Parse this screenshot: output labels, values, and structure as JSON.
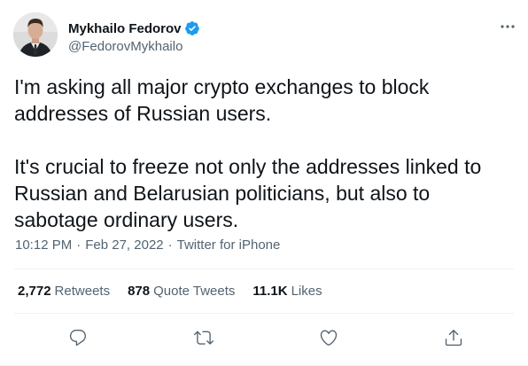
{
  "author": {
    "display_name": "Mykhailo Fedorov",
    "handle": "@FedorovMykhailo",
    "verified": true
  },
  "tweet": {
    "paragraphs": [
      "I'm asking all major crypto exchanges to block addresses of Russian users.",
      "It's crucial to freeze not only the addresses linked to Russian and Belarusian politicians, but also to sabotage ordinary users."
    ],
    "time": "10:12 PM",
    "separator": "·",
    "date": "Feb 27, 2022",
    "source": "Twitter for iPhone"
  },
  "stats": {
    "retweets": {
      "count": "2,772",
      "label": "Retweets"
    },
    "quote_tweets": {
      "count": "878",
      "label": "Quote Tweets"
    },
    "likes": {
      "count": "11.1K",
      "label": "Likes"
    }
  },
  "icons": {
    "verified": "verified-badge-icon",
    "more": "more-icon",
    "reply": "reply-icon",
    "retweet": "retweet-icon",
    "like": "like-icon",
    "share": "share-icon"
  },
  "colors": {
    "text_primary": "#0f1419",
    "text_secondary": "#536471",
    "verified_blue": "#1d9bf0",
    "divider": "#eff3f4"
  }
}
